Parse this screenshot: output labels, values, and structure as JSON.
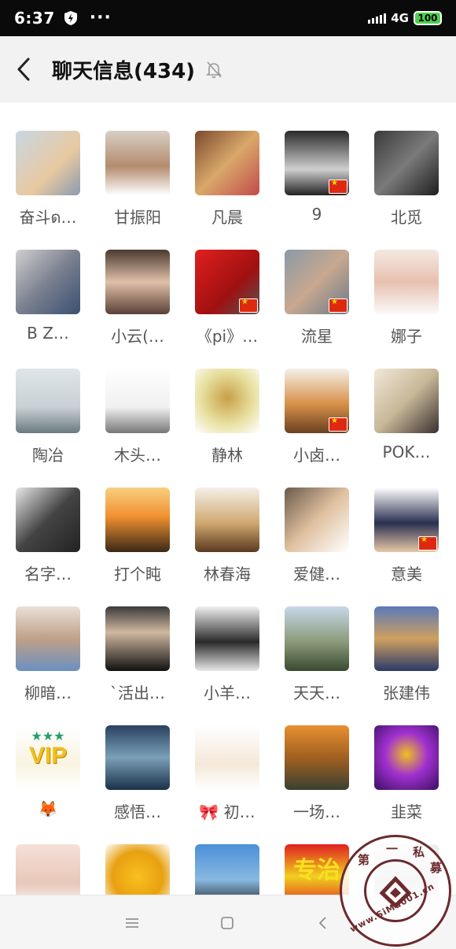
{
  "status_bar": {
    "time": "6:37",
    "network": "4G",
    "battery": "100"
  },
  "header": {
    "title": "聊天信息(434)"
  },
  "members": [
    {
      "name": "奋斗ด…",
      "bg": "linear-gradient(135deg,#c9d6e3,#e8c9a0 60%,#8a9ab0)",
      "flag": false
    },
    {
      "name": "甘振阳",
      "bg": "linear-gradient(180deg,#d8cfc4,#b48b6e 55%,#ffffff)",
      "flag": false
    },
    {
      "name": "凡晨",
      "bg": "linear-gradient(135deg,#7a4a2e,#d9a86a 50%,#c24a4a)",
      "flag": false
    },
    {
      "name": "9",
      "bg": "linear-gradient(180deg,#2a2a2a,#cfcfcf 60%,#222)",
      "flag": true
    },
    {
      "name": "北觅",
      "bg": "linear-gradient(135deg,#3a3a3a,#7a7a7a 50%,#1e1e1e)",
      "flag": false
    },
    {
      "name": "B Z…",
      "bg": "linear-gradient(135deg,#d0d0d0,#7a8090 50%,#3a5070)",
      "flag": false
    },
    {
      "name": "小云(…",
      "bg": "linear-gradient(180deg,#4a3a30,#e0c0a8 50%,#5a4036)",
      "flag": false
    },
    {
      "name": "《pi》…",
      "bg": "linear-gradient(135deg,#e02020,#a01010 60%,#555)",
      "flag": true
    },
    {
      "name": "流星",
      "bg": "linear-gradient(135deg,#8a9aa8,#c8a890 50%,#6a7a88)",
      "flag": true
    },
    {
      "name": "娜子",
      "bg": "linear-gradient(180deg,#f4e8e0,#e8c0b0 50%,#fafafa)",
      "flag": false
    },
    {
      "name": "陶冶",
      "bg": "linear-gradient(180deg,#dfe6ea,#c8d0d4 60%,#6a7a80)",
      "flag": false
    },
    {
      "name": "木头…",
      "bg": "linear-gradient(180deg,#ffffff,#f0f0f0 60%,#777)",
      "flag": false
    },
    {
      "name": "静林",
      "bg": "radial-gradient(circle at 50% 45%,#c8a048,#e8e0a0 55%,#ffffff)",
      "flag": false
    },
    {
      "name": "小卤…",
      "bg": "linear-gradient(180deg,#f4f0e8,#d89048 55%,#6a4020)",
      "flag": true
    },
    {
      "name": "POK…",
      "bg": "linear-gradient(135deg,#f0e8d8,#c8b898 50%,#3a3030)",
      "flag": false
    },
    {
      "name": "名字…",
      "bg": "linear-gradient(135deg,#e8e8e8,#444 50%,#222)",
      "flag": false
    },
    {
      "name": "打个盹",
      "bg": "linear-gradient(180deg,#f8d080,#f09030 45%,#3a2818)",
      "flag": false
    },
    {
      "name": "林春海",
      "bg": "linear-gradient(180deg,#f4f0e8,#d0a870 55%,#5a3a20)",
      "flag": false
    },
    {
      "name": "爱健…",
      "bg": "linear-gradient(135deg,#6a5a4a,#e0c0a0 50%,#ffffff)",
      "flag": false
    },
    {
      "name": "意美",
      "bg": "linear-gradient(180deg,#ffffff,#2a3050 55%,#e8c8a8)",
      "flag": true
    },
    {
      "name": "柳暗…",
      "bg": "linear-gradient(180deg,#e8e0d8,#c0a088 50%,#6a90c0)",
      "flag": false
    },
    {
      "name": "`活出…",
      "bg": "linear-gradient(180deg,#3a3a3a,#d0b8a0 40%,#111)",
      "flag": false
    },
    {
      "name": "小羊…",
      "bg": "linear-gradient(180deg,#f0f0f0,#2a2a2a 55%,#e8e8e8)",
      "flag": false
    },
    {
      "name": "天天…",
      "bg": "linear-gradient(180deg,#c8d8e8,#8a9a7a 55%,#3a4a30)",
      "flag": false
    },
    {
      "name": "张建伟",
      "bg": "linear-gradient(180deg,#5a7ab8,#d0a060 50%,#2a3a6a)",
      "flag": false
    },
    {
      "name": "🦊",
      "bg": "linear-gradient(180deg,#ffffff,#f8f4e0 60%,#ffffff)",
      "flag": false,
      "vip": "VIP"
    },
    {
      "name": "感悟…",
      "bg": "linear-gradient(180deg,#2a4060,#7aa0b8 50%,#1a3048)",
      "flag": false
    },
    {
      "name": "🎀 初…",
      "bg": "linear-gradient(180deg,#ffffff,#f4e8d8 60%,#ffffff)",
      "flag": false
    },
    {
      "name": "一场…",
      "bg": "linear-gradient(180deg,#e89030,#a06020 50%,#3a4030)",
      "flag": false
    },
    {
      "name": "韭菜",
      "bg": "radial-gradient(circle at 50% 45%,#f0c020,#a030d0 45%,#3a1060)",
      "flag": false
    },
    {
      "name": "",
      "bg": "linear-gradient(180deg,#f4e0d8,#e8c8b8 60%,#fafafa)",
      "flag": false
    },
    {
      "name": "",
      "bg": "radial-gradient(circle at 50% 50%,#f8c020,#e8a010 55%,#ffffff)",
      "flag": false
    },
    {
      "name": "",
      "bg": "linear-gradient(180deg,#4a90d8,#88b8e0 55%,#1a1a1a)",
      "flag": false
    },
    {
      "name": "",
      "bg": "linear-gradient(180deg,#e02020,#f0d020 50%,#e02020)",
      "flag": false,
      "sign": "专治"
    },
    {
      "name": "",
      "bg": "linear-gradient(180deg,#f0f0f0,#d0d0d0 60%,#ffffff)",
      "flag": false
    }
  ],
  "watermark": {
    "site": "www.SiMu001.cn",
    "chars": [
      "第",
      "一",
      "私",
      "募"
    ]
  }
}
